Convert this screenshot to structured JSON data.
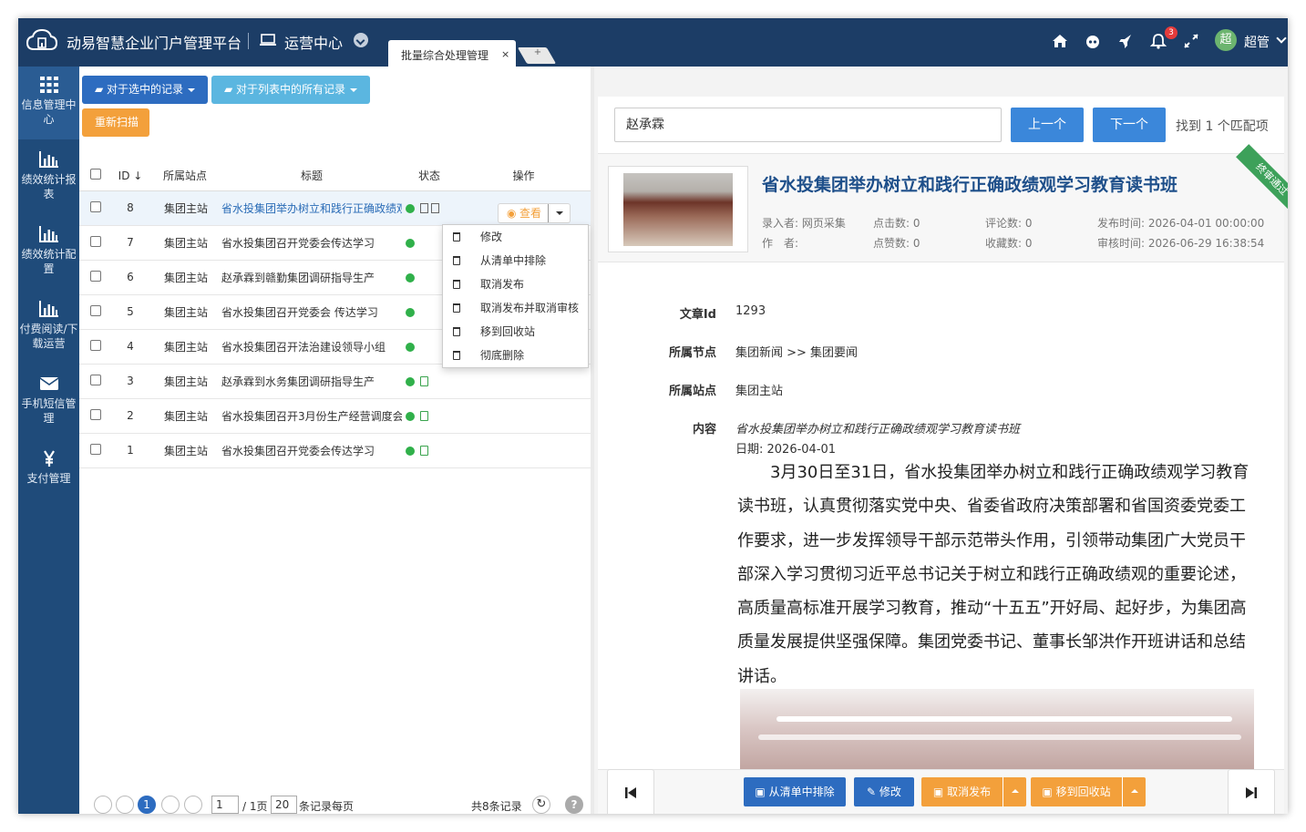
{
  "header": {
    "app_title": "动易智慧企业门户管理平台",
    "center_title": "运营中心",
    "tab_label": "批量综合处理管理",
    "tab_close": "×",
    "tab_add": "+",
    "notification_count": "3",
    "avatar_char": "超",
    "user_name": "超管"
  },
  "sidebar": {
    "items": [
      {
        "label": "信息管理中心",
        "icon": "grid-icon"
      },
      {
        "label": "绩效统计报表",
        "icon": "bar-chart-icon"
      },
      {
        "label": "绩效统计配置",
        "icon": "bar-chart-icon"
      },
      {
        "label": "付费阅读/下载运营",
        "icon": "bar-chart-icon"
      },
      {
        "label": "手机短信管理",
        "icon": "envelope-icon"
      },
      {
        "label": "支付管理",
        "icon": "yen-icon"
      }
    ]
  },
  "toolbar": {
    "selected_label": "对于选中的记录",
    "all_label": "对于列表中的所有记录",
    "rescan_label": "重新扫描"
  },
  "table": {
    "headers": {
      "id": "ID",
      "site": "所属站点",
      "title": "标题",
      "status": "状态",
      "action": "操作"
    },
    "rows": [
      {
        "id": "8",
        "site": "集团主站",
        "title": "省水投集团举办树立和践行正确政绩观学习教育读书班"
      },
      {
        "id": "7",
        "site": "集团主站",
        "title": "省水投集团召开党委会传达学习"
      },
      {
        "id": "6",
        "site": "集团主站",
        "title": "赵承霖到赣勤集团调研指导生产"
      },
      {
        "id": "5",
        "site": "集团主站",
        "title": "省水投集团召开党委会 传达学习"
      },
      {
        "id": "4",
        "site": "集团主站",
        "title": "省水投集团召开法治建设领导小组"
      },
      {
        "id": "3",
        "site": "集团主站",
        "title": "赵承霖到水务集团调研指导生产"
      },
      {
        "id": "2",
        "site": "集团主站",
        "title": "省水投集团召开3月份生产经营调度会"
      },
      {
        "id": "1",
        "site": "集团主站",
        "title": "省水投集团召开党委会传达学习"
      }
    ],
    "view_label": "查看"
  },
  "dropdown": {
    "items": [
      "修改",
      "从清单中排除",
      "取消发布",
      "取消发布并取消审核",
      "移到回收站",
      "彻底删除"
    ]
  },
  "pager": {
    "current_page": "1",
    "page_input": "1",
    "page_total": "/ 1页",
    "page_size": "20",
    "page_size_suffix": "条记录每页",
    "total_records": "共8条记录"
  },
  "search": {
    "query": "赵承霖",
    "prev_label": "上一个",
    "next_label": "下一个",
    "match_text": "找到 1 个匹配项"
  },
  "article": {
    "title": "省水投集团举办树立和践行正确政绩观学习教育读书班",
    "ribbon": "终审通过",
    "recorder": "录入者: 网页采集",
    "author": "作　者:",
    "hits": "点击数: 0",
    "likes": "点赞数: 0",
    "comments": "评论数: 0",
    "favorites": "收藏数: 0",
    "publish_time": "发布时间: 2026-04-01 00:00:00",
    "audit_time": "审核时间: 2026-06-29 16:38:54",
    "fields": {
      "id_label": "文章Id",
      "id_value": "1293",
      "node_label": "所属节点",
      "node_value": "集团新闻 >> 集团要闻",
      "site_label": "所属站点",
      "site_value": "集团主站",
      "content_label": "内容"
    },
    "content_title": "省水投集团举办树立和践行正确政绩观学习教育读书班",
    "content_date": "日期: 2026-04-01",
    "content_body": "3月30日至31日，省水投集团举办树立和践行正确政绩观学习教育读书班，认真贯彻落实党中央、省委省政府决策部署和省国资委党委工作要求，进一步发挥领导干部示范带头作用，引领带动集团广大党员干部深入学习贯彻习近平总书记关于树立和践行正确政绩观的重要论述，高质量高标准开展学习教育，推动“十五五”开好局、起好步，为集团高质量发展提供坚强保障。集团党委书记、董事长邹洪作开班讲话和总结讲话。"
  },
  "actions": {
    "exclude_label": "从清单中排除",
    "edit_label": "修改",
    "unpublish_label": "取消发布",
    "recycle_label": "移到回收站"
  },
  "colors": {
    "topbar": "#1c3d66",
    "sidebar": "#1f4b7a",
    "primary": "#2d6cc0",
    "warning": "#f3a03b",
    "success": "#3da15a"
  }
}
